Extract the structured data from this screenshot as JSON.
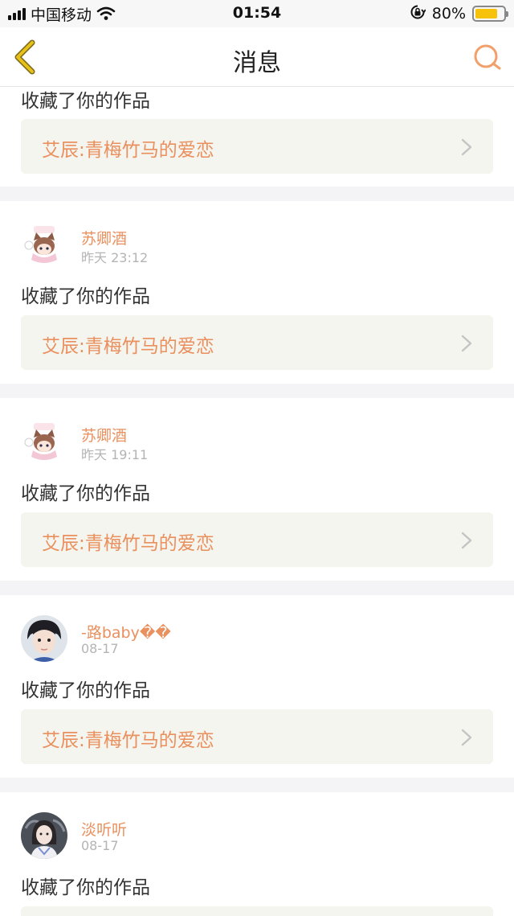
{
  "status_bar": {
    "carrier": "中国移动",
    "time": "01:54",
    "battery_percent": "80%",
    "battery_level": 0.8,
    "battery_color": "#f7c30a"
  },
  "nav": {
    "title": "消息",
    "back_icon": "chevron-left-icon",
    "search_icon": "search-icon"
  },
  "theme": {
    "accent": "#e9905e",
    "back_color": "#e8c01a"
  },
  "messages": [
    {
      "action": "收藏了你的作品",
      "work_title": "艾辰:青梅竹马的爱恋"
    },
    {
      "user": "苏卿酒",
      "time": "昨天 23:12",
      "action": "收藏了你的作品",
      "work_title": "艾辰:青梅竹马的爱恋",
      "avatar_icon": "anime-cat-avatar"
    },
    {
      "user": "苏卿酒",
      "time": "昨天 19:11",
      "action": "收藏了你的作品",
      "work_title": "艾辰:青梅竹马的爱恋",
      "avatar_icon": "anime-cat-avatar"
    },
    {
      "user": "-路baby��",
      "time": "08-17",
      "action": "收藏了你的作品",
      "work_title": "艾辰:青梅竹马的爱恋",
      "avatar_icon": "boy-photo-avatar"
    },
    {
      "user": "淡听听",
      "time": "08-17",
      "action": "收藏了你的作品",
      "avatar_icon": "girl-photo-avatar"
    }
  ]
}
